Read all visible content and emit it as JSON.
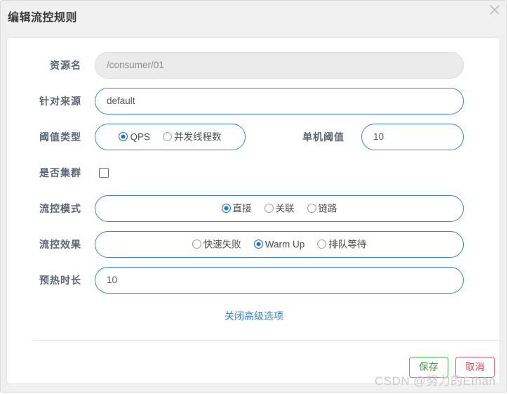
{
  "dialog": {
    "title": "编辑流控规则",
    "close_icon": "close-icon"
  },
  "form": {
    "resource": {
      "label": "资源名",
      "value": "/consumer/01",
      "placeholder": "资源名",
      "disabled": true
    },
    "origin": {
      "label": "针对来源",
      "value": "default",
      "placeholder": "default"
    },
    "threshold_type": {
      "label": "阈值类型",
      "options": [
        "QPS",
        "并发线程数"
      ],
      "selected": "QPS"
    },
    "single_threshold": {
      "label": "单机阈值",
      "value": "10",
      "placeholder": "单机阈值"
    },
    "is_cluster": {
      "label": "是否集群",
      "checked": false
    },
    "flow_mode": {
      "label": "流控模式",
      "options": [
        "直接",
        "关联",
        "链路"
      ],
      "selected": "直接"
    },
    "flow_effect": {
      "label": "流控效果",
      "options": [
        "快速失败",
        "Warm Up",
        "排队等待"
      ],
      "selected": "Warm Up"
    },
    "warmup_duration": {
      "label": "预热时长",
      "value": "10",
      "placeholder": "预热时长"
    },
    "advanced_link": "关闭高级选项"
  },
  "footer": {
    "save_label": "保存",
    "cancel_label": "取消"
  },
  "watermark": "CSDN @努力的Ethan",
  "colors": {
    "accent_blue": "#3d85c6",
    "radio_blue": "#1a73e8",
    "save_green": "#41a043",
    "cancel_red": "#d9455a",
    "link_blue": "#3d85c6"
  }
}
